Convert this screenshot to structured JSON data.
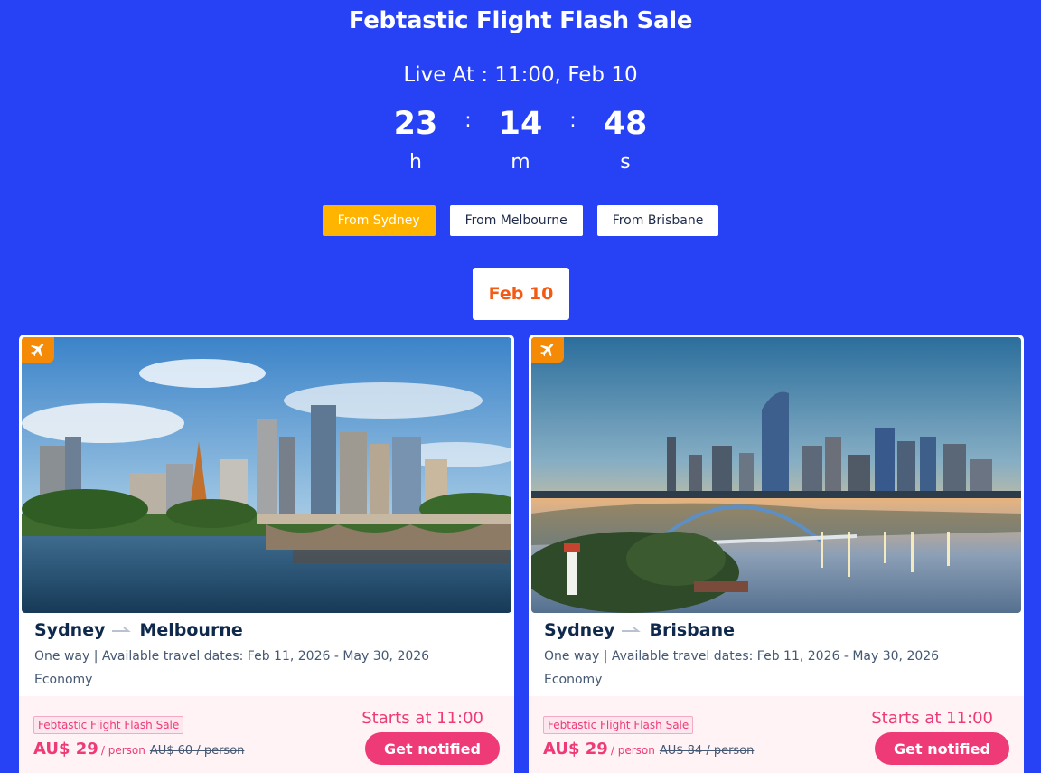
{
  "header": {
    "title": "Febtastic Flight Flash Sale",
    "live_at": "Live At : 11:00, Feb 10"
  },
  "countdown": {
    "hours": "23",
    "hours_label": "h",
    "minutes": "14",
    "minutes_label": "m",
    "seconds": "48",
    "seconds_label": "s",
    "separator": ":"
  },
  "tabs": [
    {
      "label": "From Sydney",
      "active": true
    },
    {
      "label": "From Melbourne",
      "active": false
    },
    {
      "label": "From Brisbane",
      "active": false
    }
  ],
  "date_chip": "Feb 10",
  "cards": [
    {
      "origin": "Sydney",
      "destination": "Melbourne",
      "details": "One way | Available travel dates:  Feb 11, 2026  - May 30, 2026",
      "cabin": "Economy",
      "sale_tag": "Febtastic Flight Flash Sale",
      "price": "AU$ 29",
      "per_person": "/ person",
      "original_price": "AU$ 60 / person",
      "starts_at": "Starts at 11:00",
      "button_label": "Get notified",
      "icon": "plane-icon"
    },
    {
      "origin": "Sydney",
      "destination": "Brisbane",
      "details": "One way | Available travel dates:  Feb 11, 2026  - May 30, 2026",
      "cabin": "Economy",
      "sale_tag": "Febtastic Flight Flash Sale",
      "price": "AU$ 29",
      "per_person": "/ person",
      "original_price": "AU$ 84 / person",
      "starts_at": "Starts at 11:00",
      "button_label": "Get notified",
      "icon": "plane-icon"
    }
  ],
  "colors": {
    "background": "#2741f5",
    "active_tab": "#ffb400",
    "accent_pink": "#ee3a76",
    "date_orange": "#f35b14",
    "badge_orange": "#f58a07"
  }
}
